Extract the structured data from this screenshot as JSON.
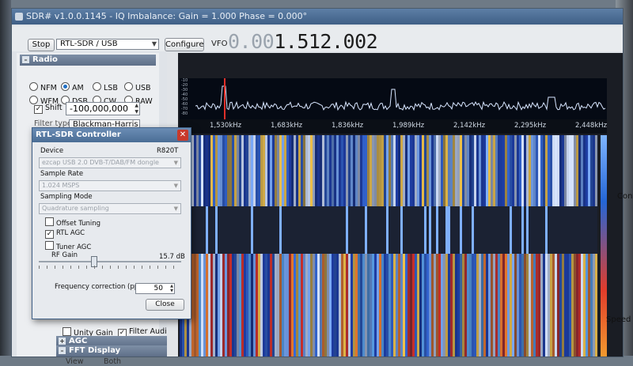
{
  "window": {
    "title": "SDR# v1.0.0.1145 - IQ Imbalance: Gain = 1.000 Phase = 0.000°"
  },
  "toolbar": {
    "stop_label": "Stop",
    "source_value": "RTL-SDR / USB",
    "configure_label": "Configure",
    "vfo_label": "VFO",
    "vfo_dim": "0.00",
    "vfo_bright": "1.512.002"
  },
  "radio": {
    "header": "Radio",
    "modes": [
      {
        "label": "NFM",
        "selected": false
      },
      {
        "label": "AM",
        "selected": true
      },
      {
        "label": "LSB",
        "selected": false
      },
      {
        "label": "USB",
        "selected": false
      },
      {
        "label": "WFM",
        "selected": false
      },
      {
        "label": "DSB",
        "selected": false
      },
      {
        "label": "CW",
        "selected": false
      },
      {
        "label": "RAW",
        "selected": false
      }
    ],
    "shift_label": "Shift",
    "shift_value": "-100,000,000",
    "filter_label": "Filter type",
    "filter_value": "Blackman-Harris"
  },
  "spectrum": {
    "db_ticks": [
      "-10",
      "-20",
      "-30",
      "-40",
      "-50",
      "-60",
      "-70",
      "-80"
    ],
    "freq_labels": [
      "1,530kHz",
      "1,683kHz",
      "1,836kHz",
      "1,989kHz",
      "2,142kHz",
      "2,295kHz",
      "2,448kHz"
    ]
  },
  "side": {
    "contrast_label": "Contr",
    "speed_label": "Speed"
  },
  "bottom": {
    "unity_gain": "Unity Gain",
    "filter_audio": "Filter Audio",
    "agc_header": "AGC",
    "fft_header": "FFT Display",
    "view_label": "View",
    "both_label": "Both"
  },
  "dialog": {
    "title": "RTL-SDR Controller",
    "device_label": "Device",
    "device_tuner": "R820T",
    "device_value": "ezcap USB 2.0 DVB-T/DAB/FM dongle",
    "sample_rate_label": "Sample Rate",
    "sample_rate_value": "1.024 MSPS",
    "sampling_mode_label": "Sampling Mode",
    "sampling_mode_value": "Quadrature sampling",
    "offset_tuning": "Offset Tuning",
    "rtl_agc": "RTL AGC",
    "tuner_agc": "Tuner AGC",
    "rf_gain_label": "RF Gain",
    "rf_gain_value": "15.7 dB",
    "rf_gain_fraction": 0.38,
    "freq_corr_label": "Frequency correction (ppm)",
    "freq_corr_value": "50",
    "close_label": "Close"
  },
  "colors": {
    "accent": "#3f5f86",
    "vfo_marker": "#e0302a"
  }
}
